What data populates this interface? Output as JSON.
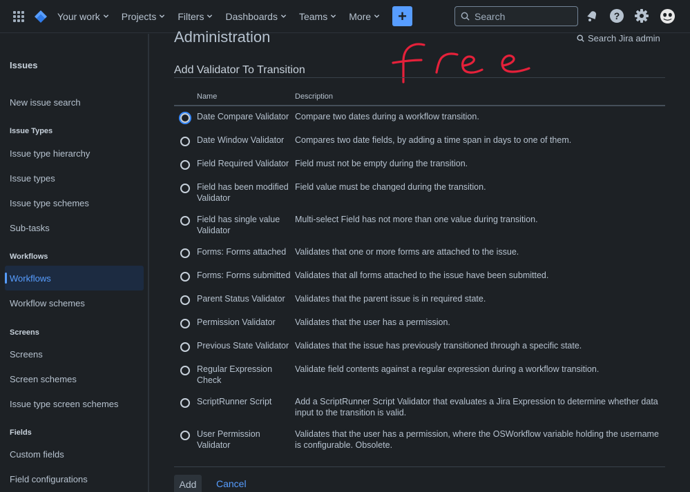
{
  "topnav": {
    "items": [
      {
        "label": "Your work"
      },
      {
        "label": "Projects"
      },
      {
        "label": "Filters"
      },
      {
        "label": "Dashboards"
      },
      {
        "label": "Teams"
      },
      {
        "label": "More"
      }
    ],
    "create_label": "+",
    "search_placeholder": "Search",
    "icons": [
      "app-switcher-icon",
      "jira-logo-icon",
      "notifications-icon",
      "help-icon",
      "settings-icon",
      "avatar"
    ],
    "accent_color": "#579dff"
  },
  "sidebar": {
    "title": "Issues",
    "items": {
      "new_issue_search": "New issue search",
      "issue_types_heading": "Issue Types",
      "issue_type_hierarchy": "Issue type hierarchy",
      "issue_types": "Issue types",
      "issue_type_schemes": "Issue type schemes",
      "sub_tasks": "Sub-tasks",
      "workflows_heading": "Workflows",
      "workflows": "Workflows",
      "workflow_schemes": "Workflow schemes",
      "screens_heading": "Screens",
      "screens": "Screens",
      "screen_schemes": "Screen schemes",
      "issue_type_screen_schemes": "Issue type screen schemes",
      "fields_heading": "Fields",
      "custom_fields": "Custom fields",
      "field_configurations": "Field configurations"
    },
    "active": "Workflows"
  },
  "main": {
    "admin_title": "Administration",
    "admin_search": "Search Jira admin",
    "annotation": "free",
    "page_title": "Add Validator To Transition",
    "columns": {
      "name": "Name",
      "description": "Description"
    },
    "validators": [
      {
        "name": "Date Compare Validator",
        "description": "Compare two dates during a workflow transition."
      },
      {
        "name": "Date Window Validator",
        "description": "Compares two date fields, by adding a time span in days to one of them."
      },
      {
        "name": "Field Required Validator",
        "description": "Field must not be empty during the transition."
      },
      {
        "name": "Field has been modified Validator",
        "description": "Field value must be changed during the transition."
      },
      {
        "name": "Field has single value Validator",
        "description": "Multi-select Field has not more than one value during transition."
      },
      {
        "name": "Forms: Forms attached",
        "description": "Validates that one or more forms are attached to the issue."
      },
      {
        "name": "Forms: Forms submitted",
        "description": "Validates that all forms attached to the issue have been submitted."
      },
      {
        "name": "Parent Status Validator",
        "description": "Validates that the parent issue is in required state."
      },
      {
        "name": "Permission Validator",
        "description": "Validates that the user has a permission."
      },
      {
        "name": "Previous State Validator",
        "description": "Validates that the issue has previously transitioned through a specific state."
      },
      {
        "name": "Regular Expression Check",
        "description": "Validate field contents against a regular expression during a workflow transition."
      },
      {
        "name": "ScriptRunner Script",
        "description": "Add a ScriptRunner Script Validator that evaluates a Jira Expression to determine whether data input to the transition is valid."
      },
      {
        "name": "User Permission Validator",
        "description": "Validates that the user has a permission, where the OSWorkflow variable holding the username is configurable. Obsolete."
      }
    ],
    "buttons": {
      "add": "Add",
      "cancel": "Cancel"
    }
  }
}
